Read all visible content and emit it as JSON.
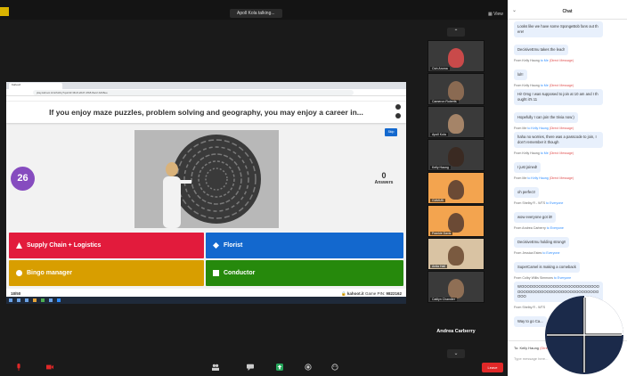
{
  "meeting": {
    "speaking_label": "Apoll Kola talking...",
    "view_label": "View",
    "active_speaker": "Andrea Carberry",
    "leave_label": "Leave"
  },
  "browser": {
    "tab_label": "Kahoot!",
    "url": "play.kahoot.it/v2/lobby?quizId=3bdf-a5d7-4fb8-8ac2-b2b8ee"
  },
  "kahoot": {
    "question": "If you enjoy maze puzzles, problem solving and geography, you may enjoy a career in...",
    "timer": "26",
    "skip_label": "Skip",
    "answers_count": "0",
    "answers_label": "Answers",
    "options": [
      {
        "label": "Supply Chain + Logistics",
        "shape": "triangle",
        "color": "#e21b3c"
      },
      {
        "label": "Florist",
        "shape": "diamond",
        "color": "#1368ce"
      },
      {
        "label": "Bingo manager",
        "shape": "circle",
        "color": "#d89e00"
      },
      {
        "label": "Conductor",
        "shape": "square",
        "color": "#26890c"
      }
    ],
    "question_count": "18/50",
    "brand": "kahoot.it",
    "game_pin_label": "Game PIN:",
    "game_pin": "9822162"
  },
  "participants": [
    {
      "name": "Ooh Aroma",
      "bg": "#c94a4a"
    },
    {
      "name": "Cameron Roberts",
      "bg": "#4a4a4a"
    },
    {
      "name": "Apoll Kola",
      "bg": "#6b5a4a"
    },
    {
      "name": "Kelly Haung",
      "bg": "#555555"
    },
    {
      "name": "GAMUB",
      "bg": "#f3a44f"
    },
    {
      "name": "Frankie Davis",
      "bg": "#f3a44f"
    },
    {
      "name": "Anita Hall",
      "bg": "#f0a050"
    },
    {
      "name": "Caitlyn Chandler",
      "bg": "#4a4a4a"
    }
  ],
  "chat": {
    "title": "Chat",
    "messages": [
      {
        "from": "",
        "to": "",
        "dm": "",
        "text": "Looks like we have some SpongeBob fans out there!"
      },
      {
        "from": "",
        "to": "",
        "dm": "",
        "text": "DecisiveEmu takes the lead!"
      },
      {
        "from": "From Kelly Haung",
        "to": "to Me",
        "dm": "(Direct Message)",
        "text": "lol!!"
      },
      {
        "from": "From Kelly Haung",
        "to": "to Me",
        "dm": "(Direct Message)",
        "text": "Hi! Omg I was supposed to join at 10 am and I thought it's 11"
      },
      {
        "from": "",
        "to": "",
        "dm": "",
        "text": "Hopefully I can join the trivia now:)"
      },
      {
        "from": "From Me",
        "to": "to Kelly Haung",
        "dm": "(Direct Message)",
        "text": "haha no worries, there was a passcode to join, I don't remember it though"
      },
      {
        "from": "From Kelly Haung",
        "to": "to Me",
        "dm": "(Direct Message)",
        "text": "I just joined!"
      },
      {
        "from": "From Me",
        "to": "to Kelly Haung",
        "dm": "(Direct Message)",
        "text": "oh perfect!"
      },
      {
        "from": "From Shelby R - WTS",
        "to": "to Everyone",
        "dm": "",
        "text": "wow everyone got it!!"
      },
      {
        "from": "From Andrea Carberry",
        "to": "to Everyone",
        "dm": "",
        "text": "DecisiveEmu holding strong!!"
      },
      {
        "from": "From Jessica Estes",
        "to": "to Everyone",
        "dm": "",
        "text": "SuperCamel is making a comeback"
      },
      {
        "from": "From Colby Willis Simmons",
        "to": "to Everyone",
        "dm": "",
        "text": "WOOOOOOOOOOOOOOOOOOOOOOOOOOOOOOOOOOOOOOOOOOOOOOOOOOOOOOOOOO"
      },
      {
        "from": "From Shelby R - WTS",
        "to": "",
        "dm": "",
        "text": "Way to go Ca..."
      }
    ],
    "input_to": "To: Kelly Haung",
    "input_dm": "(Direct Message)",
    "input_placeholder": "Type message here..."
  },
  "colors": {
    "kahoot_purple": "#864cbf",
    "zoom_blue": "#2d8cff",
    "leave_red": "#e02828"
  }
}
